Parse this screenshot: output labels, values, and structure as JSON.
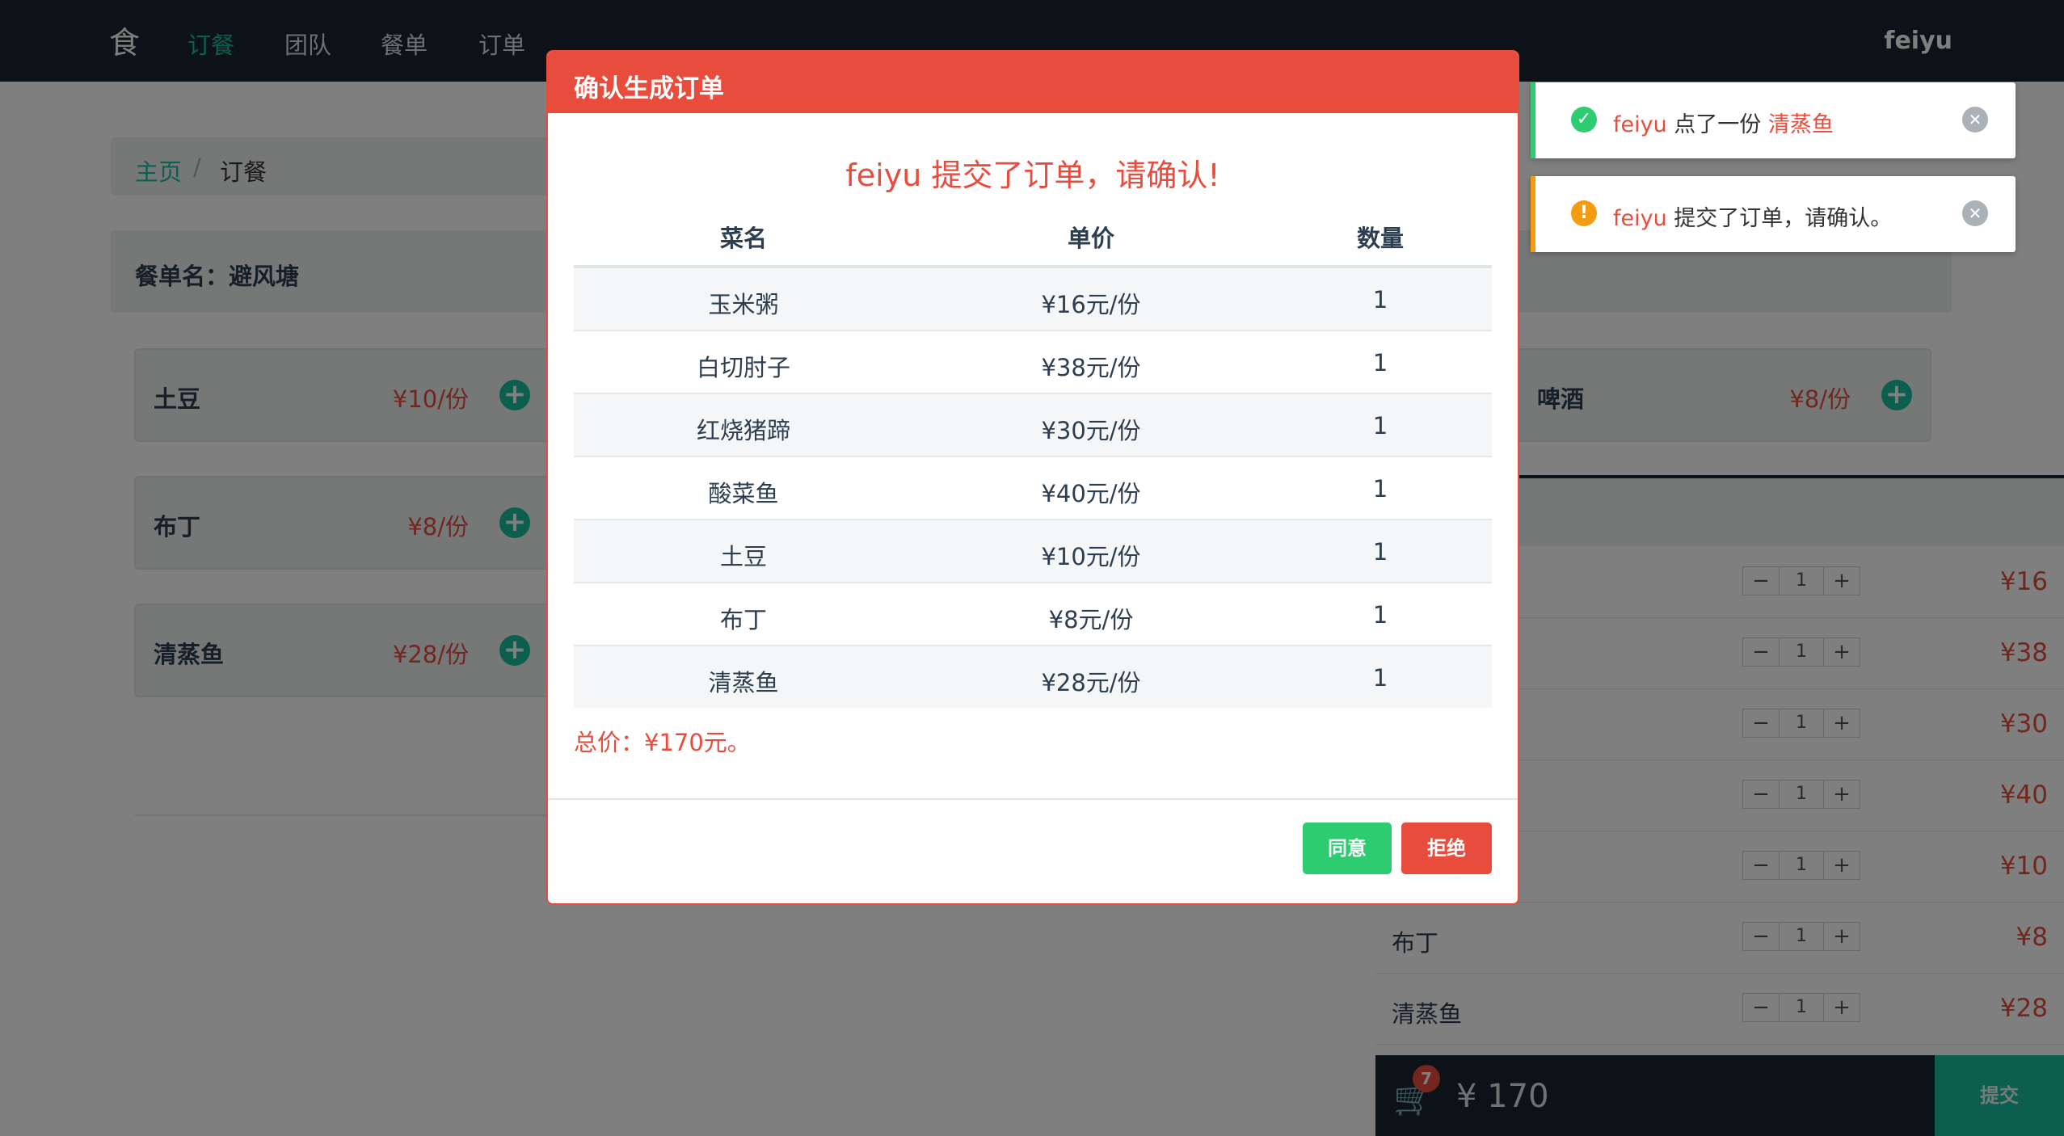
{
  "nav": {
    "logo": "食",
    "items": [
      "订餐",
      "团队",
      "餐单",
      "订单"
    ],
    "user": "feiyu"
  },
  "breadcrumb": {
    "home": "主页",
    "separator": "/",
    "current": "订餐"
  },
  "menu_title": "餐单名：避风塘",
  "dishes": [
    {
      "name": "土豆",
      "price": "¥10/份"
    },
    {
      "name": "布丁",
      "price": "¥8/份"
    },
    {
      "name": "清蒸鱼",
      "price": "¥28/份"
    },
    {
      "name": "啤酒",
      "price": "¥8/份"
    }
  ],
  "cart": {
    "rows": [
      {
        "name": "",
        "qty": "1",
        "price": "¥16"
      },
      {
        "name": "",
        "qty": "1",
        "price": "¥38"
      },
      {
        "name": "",
        "qty": "1",
        "price": "¥30"
      },
      {
        "name": "",
        "qty": "1",
        "price": "¥40"
      },
      {
        "name": "",
        "qty": "1",
        "price": "¥10"
      },
      {
        "name": "布丁",
        "qty": "1",
        "price": "¥8"
      },
      {
        "name": "清蒸鱼",
        "qty": "1",
        "price": "¥28"
      }
    ],
    "minus": "−",
    "plus": "+",
    "badge": "7",
    "total": "¥ 170",
    "submit": "提交"
  },
  "modal": {
    "title": "确认生成订单",
    "heading": "feiyu 提交了订单，请确认!",
    "columns": [
      "菜名",
      "单价",
      "数量"
    ],
    "rows": [
      {
        "name": "玉米粥",
        "price": "¥16元/份",
        "qty": "1"
      },
      {
        "name": "白切肘子",
        "price": "¥38元/份",
        "qty": "1"
      },
      {
        "name": "红烧猪蹄",
        "price": "¥30元/份",
        "qty": "1"
      },
      {
        "name": "酸菜鱼",
        "price": "¥40元/份",
        "qty": "1"
      },
      {
        "name": "土豆",
        "price": "¥10元/份",
        "qty": "1"
      },
      {
        "name": "布丁",
        "price": "¥8元/份",
        "qty": "1"
      },
      {
        "name": "清蒸鱼",
        "price": "¥28元/份",
        "qty": "1"
      }
    ],
    "total": "总价：¥170元。",
    "agree": "同意",
    "reject": "拒绝"
  },
  "toasts": [
    {
      "user": "feiyu",
      "text": " 点了一份 ",
      "item": "清蒸鱼",
      "type": "success",
      "icon": "check-icon"
    },
    {
      "user": "feiyu",
      "text": " 提交了订单，请确认。",
      "item": "",
      "type": "warning",
      "icon": "exclamation-icon"
    }
  ],
  "colors": {
    "navbar": "#1b2533",
    "accent": "#18bc9c",
    "danger": "#e74c3c",
    "success": "#2ecc71",
    "warning": "#f39c12"
  }
}
